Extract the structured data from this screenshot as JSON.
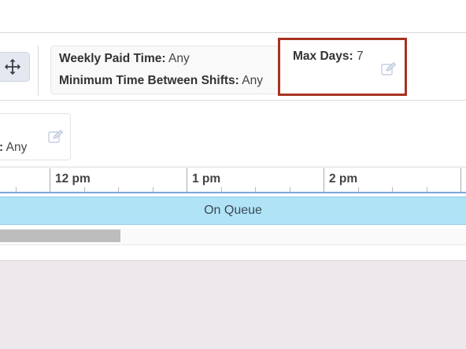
{
  "constraints": {
    "weekly_paid_time": {
      "label": "Weekly Paid Time:",
      "value": " Any"
    },
    "min_time_between_shifts": {
      "label": "Minimum Time Between Shifts:",
      "value": " Any"
    },
    "max_days": {
      "label": "Max Days:",
      "value": " 7"
    }
  },
  "second_row": {
    "label": ":",
    "value": "  Any"
  },
  "timeline": {
    "hours": [
      "12 pm",
      "1 pm",
      "2 pm"
    ]
  },
  "activity": {
    "label": "On Queue",
    "color": "#b1e3f7"
  },
  "icons": {
    "move": "move-arrows-icon",
    "edit": "edit-pencil-icon"
  },
  "colors": {
    "highlight_border": "#a8321f",
    "timeline_line": "#7aa6dd"
  }
}
